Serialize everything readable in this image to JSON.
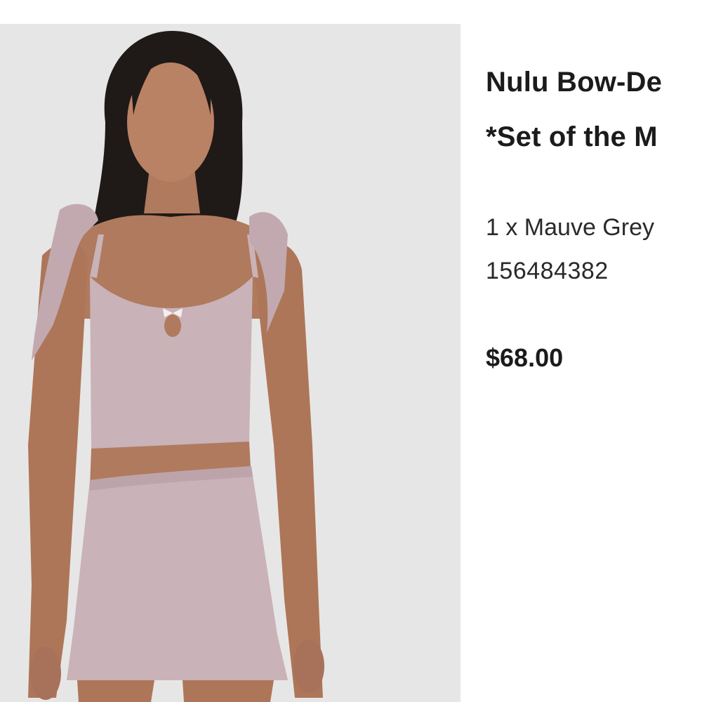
{
  "product": {
    "title_line_1": "Nulu Bow-De",
    "title_line_2": "*Set of the M",
    "variant": "1 x Mauve Grey",
    "sku": "156484382",
    "price": "$68.00"
  },
  "colors": {
    "image_background": "#e7e6e6",
    "garment": "#c9b2b8",
    "text_primary": "#1b1b1b"
  }
}
